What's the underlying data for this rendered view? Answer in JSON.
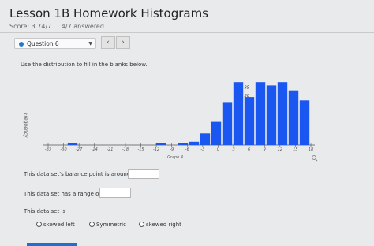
{
  "header": {
    "title": "Lesson 1B Homework Histograms",
    "score": "Score: 3.74/7",
    "answered": "4/7 answered"
  },
  "question_nav": {
    "selected": "Question 6",
    "prev_icon": "‹",
    "next_icon": "›"
  },
  "prompt": "Use the distribution to fill in the blanks below.",
  "chart_data": {
    "type": "bar",
    "xlabel": "Graph 4",
    "ylabel": "Frequency",
    "tick_labels": [
      "-33",
      "-30",
      "-27",
      "-24",
      "-21",
      "-18",
      "-15",
      "-12",
      "-9",
      "-6",
      "-3",
      "0",
      "3",
      "6",
      "9",
      "12",
      "15",
      "18"
    ],
    "values": [
      0,
      1,
      0,
      0,
      0,
      0,
      0,
      0,
      0,
      1,
      0,
      1,
      2,
      7,
      14,
      26,
      38,
      29,
      38,
      36,
      38,
      33,
      27
    ],
    "y_labels": [
      "35",
      "30"
    ],
    "color": "#1a56f0"
  },
  "blanks": {
    "balance_text": "This data set's balance point is around",
    "range_text": "This data set has a range of",
    "shape_text": "This data set is"
  },
  "options": [
    "skewed left",
    "Symmetric",
    "skewed right"
  ]
}
